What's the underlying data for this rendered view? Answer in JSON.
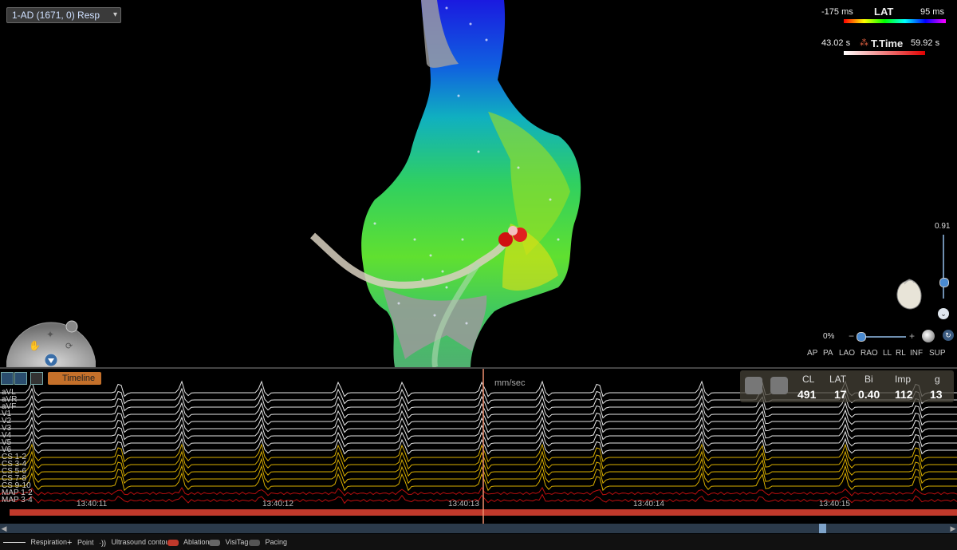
{
  "map_selector": {
    "label": "1-AD (1671, 0) Resp"
  },
  "lat_legend": {
    "min": "-175 ms",
    "title": "LAT",
    "max": "95 ms"
  },
  "time_legend": {
    "min": "43.02 s",
    "title": "T.Time",
    "max": "59.92 s"
  },
  "transparency": {
    "value": "0.91"
  },
  "zoom": {
    "value": "0%"
  },
  "view_buttons": [
    "AP",
    "PA",
    "LAO",
    "RAO",
    "LL",
    "RL",
    "INF",
    "SUP"
  ],
  "ecg": {
    "timeline_label": "Timeline",
    "speed_label": "mm/sec",
    "channels": [
      "aVL",
      "aVR",
      "aVF",
      "V1",
      "V2",
      "V3",
      "V4",
      "V5",
      "V6",
      "CS 1-2",
      "CS 3-4",
      "CS 5-6",
      "CS 7-8",
      "CS 9-10",
      "MAP 1-2",
      "MAP 3-4"
    ],
    "time_ticks": [
      "13:40:11",
      "13:40:12",
      "13:40:13",
      "13:40:14",
      "13:40:15"
    ],
    "metrics": [
      {
        "name": "CL",
        "value": "491"
      },
      {
        "name": "LAT",
        "value": "17"
      },
      {
        "name": "Bi",
        "value": "0.40"
      },
      {
        "name": "Imp",
        "value": "112"
      },
      {
        "name": "g",
        "value": "13"
      }
    ]
  },
  "status_bar": {
    "respiration": "Respiration",
    "point": "Point",
    "ultrasound": "Ultrasound contours",
    "ablation": "Ablation",
    "visitag": "VisiTag",
    "pacing": "Pacing"
  },
  "colors": {
    "accent": "#c4702a",
    "ablation": "#c0392b",
    "lat_bar": "rainbow",
    "ecg_surface": "#ffffff",
    "ecg_intracardiac": "#f2c200",
    "ecg_map": "#d01010"
  }
}
